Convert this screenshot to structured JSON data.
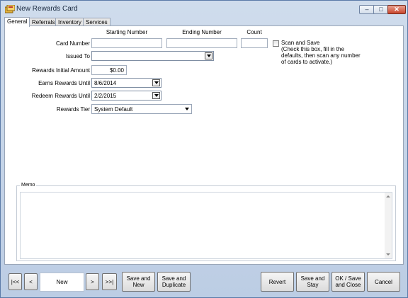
{
  "window": {
    "title": "New Rewards Card",
    "buttons": {
      "minimize": "–",
      "maximize": "□",
      "close": "✕"
    }
  },
  "tabs": [
    "General",
    "Referrals",
    "Inventory",
    "Services"
  ],
  "active_tab": "General",
  "form": {
    "columns": {
      "start": "Starting Number",
      "end": "Ending Number",
      "count": "Count"
    },
    "card_number_label": "Card Number",
    "card_number_start": "",
    "card_number_end": "",
    "card_number_count": "",
    "issued_to_label": "Issued To",
    "issued_to_value": "",
    "initial_amount_label": "Rewards Initial Amount",
    "initial_amount_value": "$0.00",
    "earns_until_label": "Earns Rewards Until",
    "earns_until_value": "8/6/2014",
    "redeem_until_label": "Redeem Rewards Until",
    "redeem_until_value": "2/2/2015",
    "tier_label": "Rewards Tier",
    "tier_value": "System Default",
    "scan_and_save_label": "Scan and Save",
    "scan_and_save_checked": false,
    "scan_and_save_hint": "(Check this box, fill in the\ndefaults, then scan any number\nof cards to activate.)",
    "memo_label": "Memo",
    "memo_value": ""
  },
  "footer": {
    "first": "|<<",
    "prev": "<",
    "record_state": "New",
    "next": ">",
    "last": ">>|",
    "save_new": "Save and\nNew",
    "save_duplicate": "Save and\nDuplicate",
    "revert": "Revert",
    "save_stay": "Save and\nStay",
    "ok_save_close": "OK / Save\nand Close",
    "cancel": "Cancel"
  }
}
